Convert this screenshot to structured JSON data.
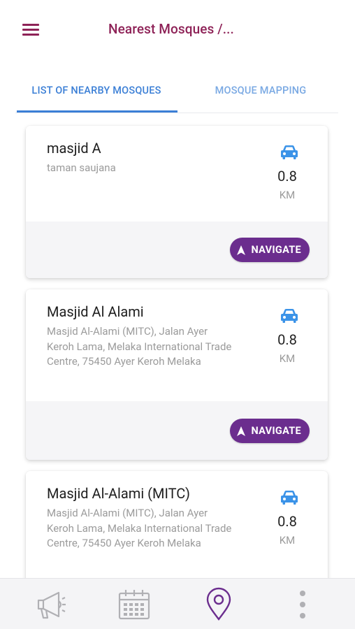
{
  "header": {
    "title": "Nearest Mosques /..."
  },
  "tabs": [
    {
      "label": "LIST OF NEARBY MOSQUES",
      "active": true
    },
    {
      "label": "MOSQUE MAPPING",
      "active": false
    }
  ],
  "mosques": [
    {
      "name": "masjid A",
      "address": "taman saujana",
      "distance": "0.8",
      "unit": "KM",
      "navigate_label": "NAVIGATE"
    },
    {
      "name": "Masjid Al Alami",
      "address": "Masjid Al-Alami (MITC), Jalan Ayer Keroh Lama, Melaka International Trade Centre, 75450 Ayer Keroh Melaka",
      "distance": "0.8",
      "unit": "KM",
      "navigate_label": "NAVIGATE"
    },
    {
      "name": "Masjid Al-Alami (MITC)",
      "address": "Masjid Al-Alami (MITC), Jalan Ayer Keroh Lama, Melaka International Trade Centre, 75450 Ayer Keroh Melaka",
      "distance": "0.8",
      "unit": "KM"
    }
  ],
  "bottom_nav": {
    "items": [
      {
        "icon": "megaphone-icon",
        "active": false
      },
      {
        "icon": "calendar-icon",
        "active": false
      },
      {
        "icon": "location-pin-icon",
        "active": true
      },
      {
        "icon": "more-vertical-icon",
        "active": false
      }
    ]
  },
  "colors": {
    "brand": "#8e2257",
    "tab_active": "#3b7fd6",
    "tab_inactive": "#7aa9e3",
    "navigate_button": "#6b2d8e",
    "car_icon": "#3b93e8",
    "nav_active": "#6b2d8e",
    "nav_inactive": "#b0b0b4"
  }
}
